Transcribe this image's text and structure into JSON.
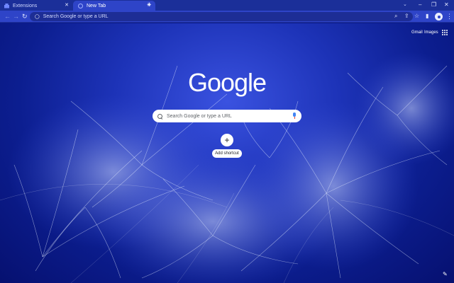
{
  "tabs": [
    {
      "label": "Extensions",
      "active": false,
      "icon": "puzzle-icon"
    },
    {
      "label": "New Tab",
      "active": true,
      "icon": "globe-icon"
    }
  ],
  "tab_close_glyph": "✕",
  "new_tab_glyph": "+",
  "window_controls": {
    "minimize": "–",
    "maximize": "❐",
    "close": "✕",
    "tab_search": "⌄"
  },
  "toolbar": {
    "back": "←",
    "forward": "→",
    "reload": "↻",
    "omnibox_placeholder": "Search Google or type a URL",
    "zoom_icon": "⌕",
    "share_icon": "⇪",
    "bookmark_icon": "☆",
    "sidepanel_icon": "▮",
    "menu": "⋮"
  },
  "ntp": {
    "gmail": "Gmail",
    "images": "Images",
    "logo": "Google",
    "search_placeholder": "Search Google or type a URL",
    "add_shortcut_glyph": "+",
    "add_shortcut_label": "Add shortcut",
    "customize_glyph": "✎"
  },
  "colors": {
    "tabstrip": "#1b2f99",
    "toolbar": "#2e44c8",
    "background_accent": "#1d33b8"
  }
}
